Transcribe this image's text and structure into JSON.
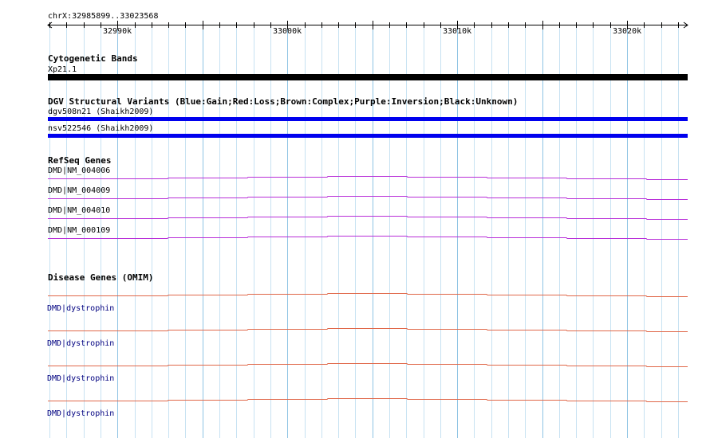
{
  "ruler": {
    "location": "chrX:32985899..33023568",
    "ticks": [
      {
        "label": "32990k",
        "pos": 32990000
      },
      {
        "label": "33000k",
        "pos": 33000000
      },
      {
        "label": "33010k",
        "pos": 33010000
      },
      {
        "label": "33020k",
        "pos": 33020000
      }
    ],
    "start": 32985899,
    "end": 33023568
  },
  "tracks": {
    "cytoband": {
      "title": "Cytogenetic Bands",
      "label": "Xp21.1",
      "color": "#000000"
    },
    "dgv": {
      "title": "DGV Structural Variants (Blue:Gain;Red:Loss;Brown:Complex;Purple:Inversion;Black:Unknown)",
      "items": [
        {
          "label": "dgv508n21 (Shaikh2009)",
          "color": "#0000ee"
        },
        {
          "label": "nsv522546 (Shaikh2009)",
          "color": "#0000ee"
        }
      ]
    },
    "refseq": {
      "title": "RefSeq Genes",
      "color": "#b82fd8",
      "items": [
        {
          "label": "DMD|NM_004006"
        },
        {
          "label": "DMD|NM_004009"
        },
        {
          "label": "DMD|NM_004010"
        },
        {
          "label": "DMD|NM_000109"
        }
      ]
    },
    "omim": {
      "title": "Disease Genes (OMIM)",
      "color": "#e0684a",
      "items": [
        {
          "label": "DMD|dystrophin"
        },
        {
          "label": "DMD|dystrophin"
        },
        {
          "label": "DMD|dystrophin"
        },
        {
          "label": "DMD|dystrophin"
        }
      ]
    }
  },
  "colors": {
    "grid_major": "#8fc4e4",
    "grid_minor": "#c7e2f2"
  }
}
